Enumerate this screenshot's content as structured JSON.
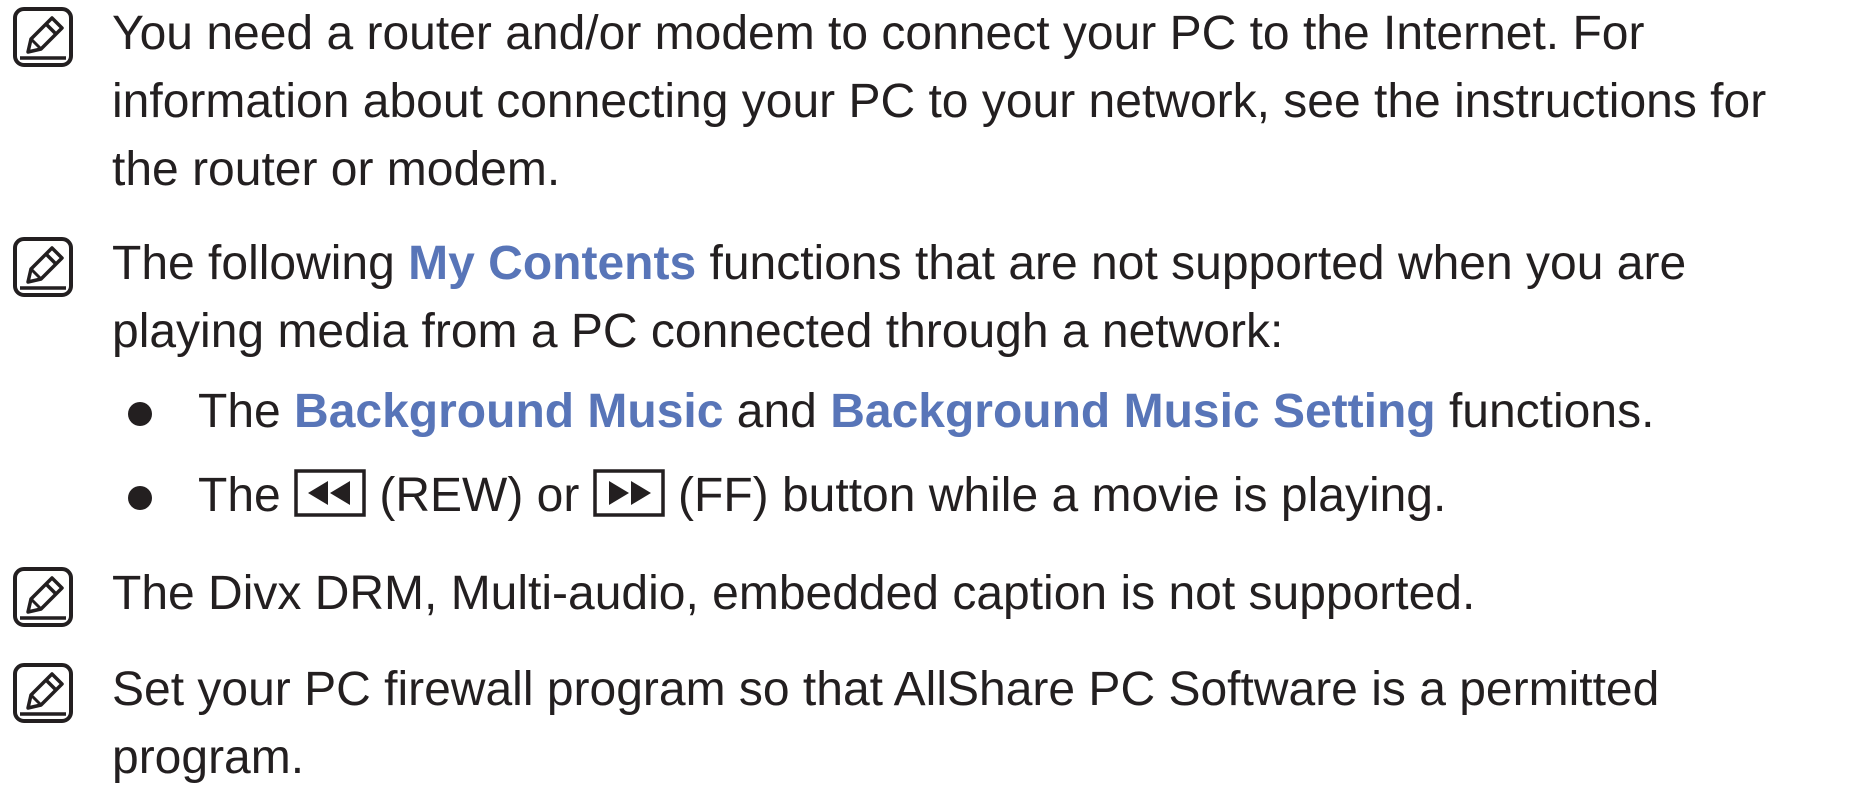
{
  "notes": [
    {
      "text": "You need a router and/or modem to connect your PC to the Internet. For information about connecting your PC to your network, see the instructions for the router or modem."
    },
    {
      "text_before": "The following ",
      "highlight": "My Contents",
      "text_after": " functions that are not supported when you are playing media from a PC connected through a network:",
      "bullets": [
        {
          "before": "The ",
          "hl1": "Background Music",
          "middle": " and ",
          "hl2": "Background Music Setting",
          "after": " functions."
        },
        {
          "before": "The ",
          "rew_label": " (REW) or ",
          "ff_label": " (FF) button while a movie is playing."
        }
      ]
    },
    {
      "text": "The Divx DRM, Multi-audio, embedded caption is not supported."
    },
    {
      "text": "Set your PC firewall program so that AllShare PC Software is a permitted program."
    }
  ],
  "icons": {
    "note": "note-pencil-icon",
    "rew": "rewind-button-icon",
    "ff": "fast-forward-button-icon"
  },
  "colors": {
    "text": "#231f20",
    "highlight": "#5875b8"
  }
}
